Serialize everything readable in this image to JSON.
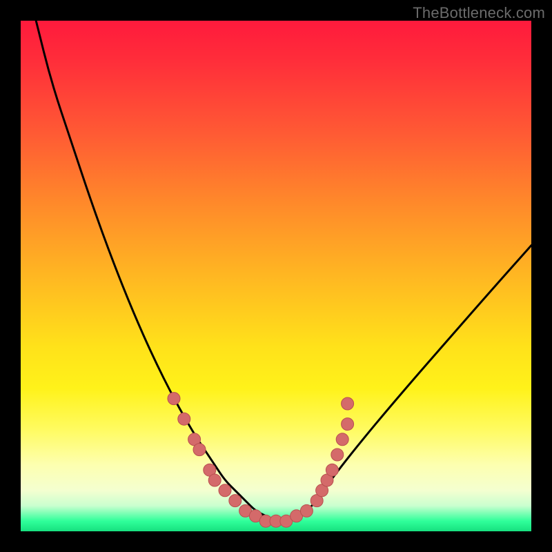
{
  "watermark": "TheBottleneck.com",
  "colors": {
    "frame": "#000000",
    "watermark": "#6b6b6b",
    "curve_stroke": "#000000",
    "dot_fill": "#d46a6a",
    "dot_stroke": "#b84f4f",
    "gradient_stops": [
      "#ff1a3c",
      "#ff2e3a",
      "#ff5a34",
      "#ff8a2a",
      "#ffb722",
      "#ffe21a",
      "#fff21a",
      "#fffb60",
      "#fdffb0",
      "#f4ffd0",
      "#c9ffcf",
      "#2fff9a",
      "#17e07f"
    ]
  },
  "chart_data": {
    "type": "line",
    "title": "",
    "xlabel": "",
    "ylabel": "",
    "xlim": [
      0,
      100
    ],
    "ylim": [
      0,
      100
    ],
    "grid": false,
    "legend": false,
    "note": "x and y are plot-area percentages (0 = left/top, 100 = right/bottom on the rendered image). Lower y visually = higher on screen; the curve plunges from top-left, flattens near bottom-center ~45–55% x, then rises toward the right edge at mid-height.",
    "series": [
      {
        "name": "bottleneck-curve",
        "x": [
          3,
          6,
          10,
          14,
          18,
          22,
          26,
          30,
          34,
          36,
          38,
          40,
          42,
          44,
          46,
          48,
          50,
          52,
          54,
          56,
          58,
          60,
          63,
          67,
          72,
          78,
          85,
          92,
          100
        ],
        "y": [
          0,
          12,
          24,
          36,
          47,
          57,
          66,
          74,
          81,
          84,
          87,
          90,
          92,
          94,
          96,
          97,
          98,
          98,
          97,
          96,
          94,
          91,
          87,
          82,
          76,
          69,
          61,
          53,
          44
        ]
      }
    ],
    "annotations": {
      "dots_note": "scatter markers clustered along both flanks near the trough",
      "dots": [
        {
          "x": 30,
          "y": 74
        },
        {
          "x": 32,
          "y": 78
        },
        {
          "x": 34,
          "y": 82
        },
        {
          "x": 35,
          "y": 84
        },
        {
          "x": 37,
          "y": 88
        },
        {
          "x": 38,
          "y": 90
        },
        {
          "x": 40,
          "y": 92
        },
        {
          "x": 42,
          "y": 94
        },
        {
          "x": 44,
          "y": 96
        },
        {
          "x": 46,
          "y": 97
        },
        {
          "x": 48,
          "y": 98
        },
        {
          "x": 50,
          "y": 98
        },
        {
          "x": 52,
          "y": 98
        },
        {
          "x": 54,
          "y": 97
        },
        {
          "x": 56,
          "y": 96
        },
        {
          "x": 58,
          "y": 94
        },
        {
          "x": 59,
          "y": 92
        },
        {
          "x": 60,
          "y": 90
        },
        {
          "x": 61,
          "y": 88
        },
        {
          "x": 62,
          "y": 85
        },
        {
          "x": 63,
          "y": 82
        },
        {
          "x": 64,
          "y": 79
        },
        {
          "x": 64,
          "y": 75
        }
      ]
    }
  }
}
